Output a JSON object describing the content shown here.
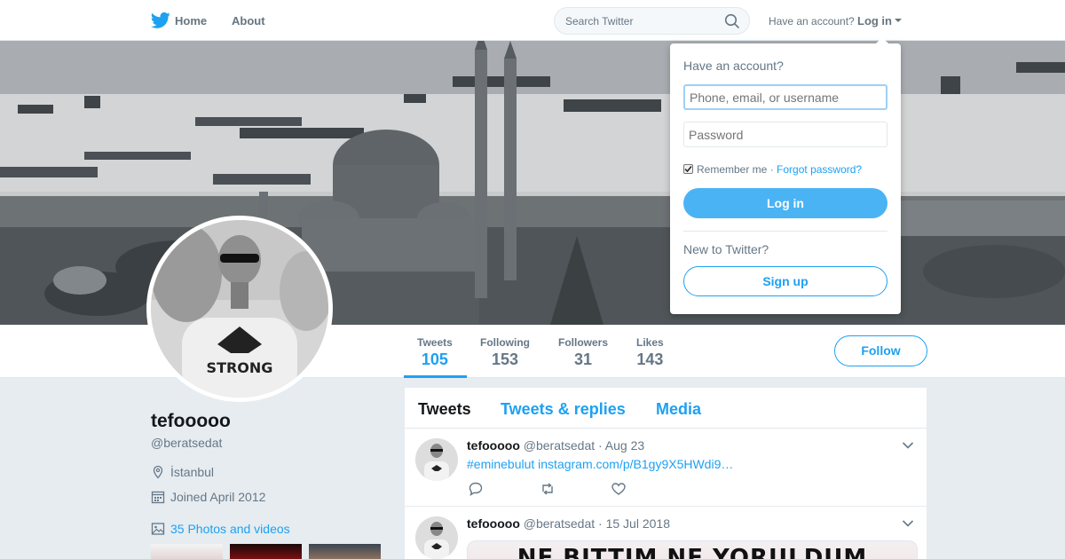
{
  "nav": {
    "home_label": "Home",
    "about_label": "About",
    "search_placeholder": "Search Twitter",
    "have_account": "Have an account?",
    "login_label": "Log in"
  },
  "profile": {
    "name": "tefooooo",
    "handle": "@beratsedat",
    "location": "İstanbul",
    "joined": "Joined April 2012",
    "photos_link": "35 Photos and videos",
    "follow_label": "Follow"
  },
  "stats": [
    {
      "label": "Tweets",
      "value": "105"
    },
    {
      "label": "Following",
      "value": "153"
    },
    {
      "label": "Followers",
      "value": "31"
    },
    {
      "label": "Likes",
      "value": "143"
    }
  ],
  "timeline": {
    "tabs": [
      "Tweets",
      "Tweets & replies",
      "Media"
    ],
    "tweets": [
      {
        "name": "tefooooo",
        "handle": "@beratsedat",
        "date": "· Aug 23",
        "text": "#eminebulut instagram.com/p/B1gy9X5HWdi9…"
      },
      {
        "name": "tefooooo",
        "handle": "@beratsedat",
        "date": "· 15 Jul 2018",
        "image_text": "NE BITTIM NE YORULDUM"
      }
    ]
  },
  "login_dropdown": {
    "title": "Have an account?",
    "username_placeholder": "Phone, email, or username",
    "password_placeholder": "Password",
    "remember_label": "Remember me",
    "separator": "·",
    "forgot_label": "Forgot password?",
    "login_button": "Log in",
    "new_to": "New to Twitter?",
    "signup_button": "Sign up"
  },
  "colors": {
    "accent": "#1da1f2",
    "login_button": "#4ab3f4",
    "background": "#e6ecf0"
  }
}
